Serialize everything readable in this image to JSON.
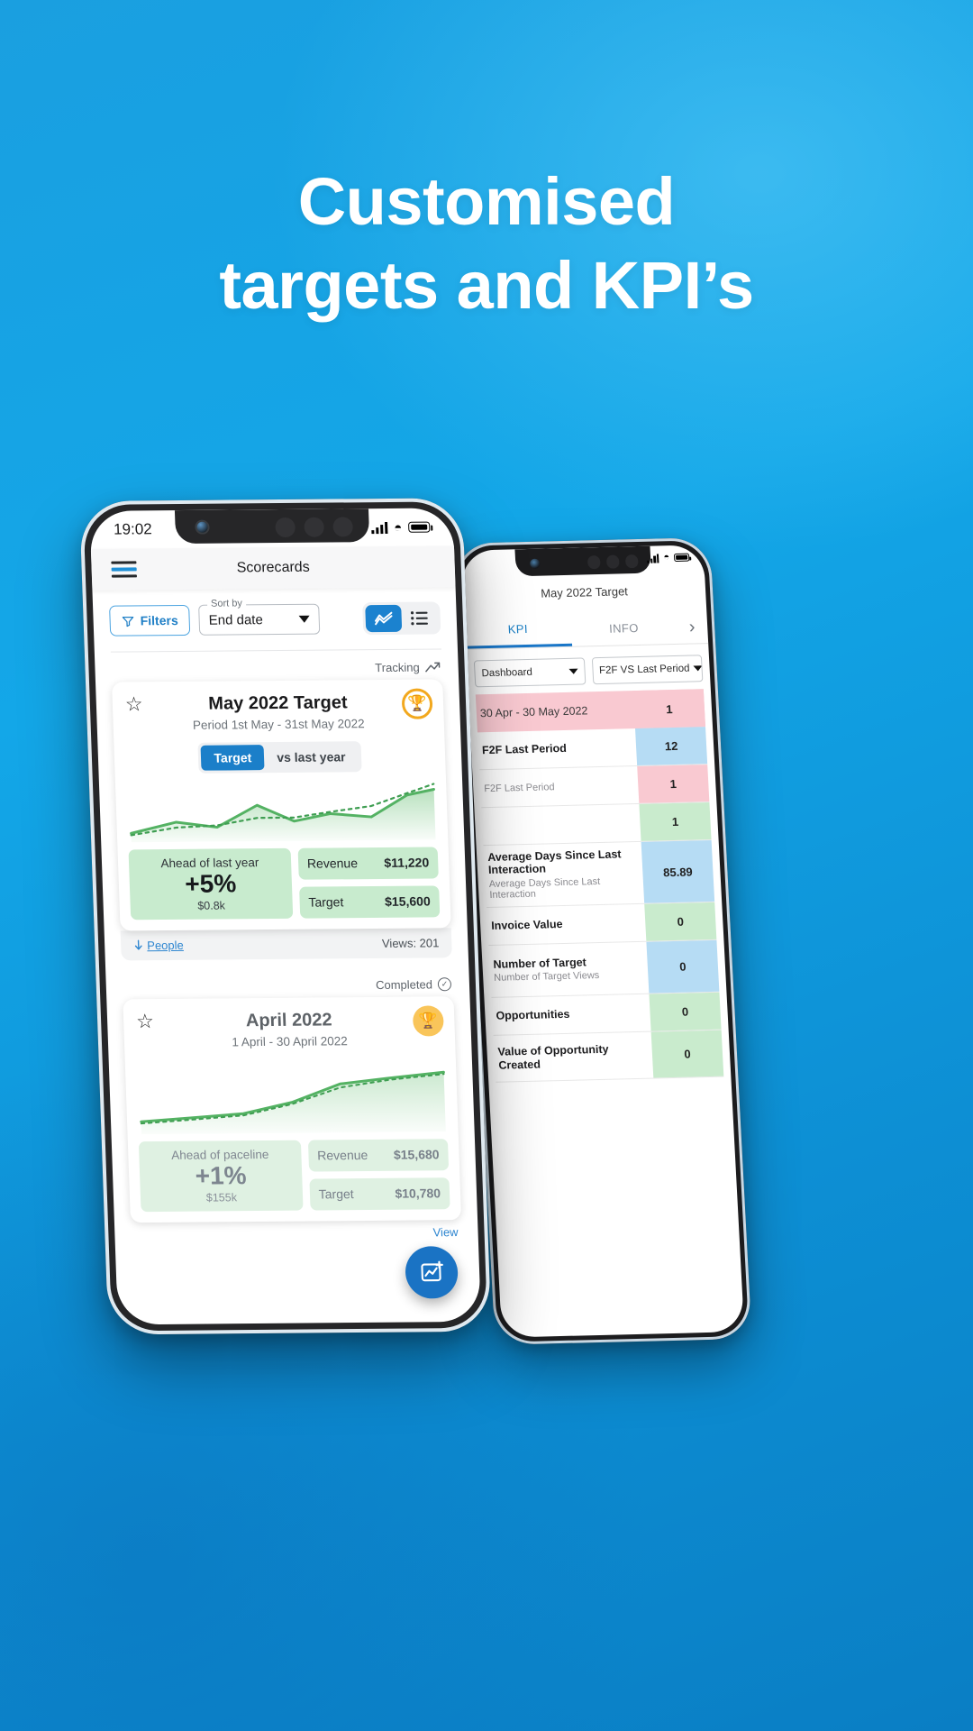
{
  "headline": {
    "line1": "Customised",
    "line2": "targets and KPI’s"
  },
  "left_phone": {
    "status": {
      "time": "19:02",
      "signal_icon": "cellular-bars-icon",
      "wifi_icon": "wifi-icon",
      "battery_icon": "battery-full-icon"
    },
    "appbar": {
      "menu_icon": "hamburger-menu-icon",
      "title": "Scorecards"
    },
    "toolbar": {
      "filters_label": "Filters",
      "filters_icon": "filter-funnel-icon",
      "sort_label": "Sort by",
      "sort_value": "End date",
      "sort_caret_icon": "chevron-down-icon",
      "chart_view_icon": "line-chart-icon",
      "list_view_icon": "list-view-icon"
    },
    "cards": [
      {
        "status_label": "Tracking",
        "status_icon": "trending-up-icon",
        "star_icon": "star-outline-icon",
        "badge_icon": "trophy-icon",
        "title": "May 2022 Target",
        "subtitle": "Period 1st May - 31st May 2022",
        "segmented": {
          "options": [
            "Target",
            "vs last year"
          ],
          "selected": "Target"
        },
        "metric_title": "Ahead of last year",
        "metric_value": "+5%",
        "metric_sub": "$0.8k",
        "rows": [
          {
            "label": "Revenue",
            "value": "$11,220"
          },
          {
            "label": "Target",
            "value": "$15,600"
          }
        ],
        "footer": {
          "people_label": "People",
          "people_icon": "download-arrow-icon",
          "views_label": "Views: 201"
        }
      },
      {
        "status_label": "Completed",
        "status_icon": "check-circle-icon",
        "star_icon": "star-outline-icon",
        "badge_icon": "trophy-icon",
        "title": "April 2022",
        "subtitle": "1 April - 30 April 2022",
        "metric_title": "Ahead of paceline",
        "metric_value": "+1%",
        "metric_sub": "$155k",
        "rows": [
          {
            "label": "Revenue",
            "value": "$15,680"
          },
          {
            "label": "Target",
            "value": "$10,780"
          }
        ],
        "footer": {
          "view_link": "View"
        }
      }
    ],
    "fab_icon": "add-chart-icon"
  },
  "right_phone": {
    "status": {
      "signal_icon": "cellular-bars-icon",
      "wifi_icon": "wifi-icon",
      "battery_icon": "battery-full-icon"
    },
    "title": "May 2022 Target",
    "tabs": {
      "items": [
        "KPI",
        "INFO"
      ],
      "selected": "KPI",
      "next_icon": "chevron-right-icon"
    },
    "selects": [
      {
        "value": "Dashboard",
        "caret_icon": "chevron-down-icon"
      },
      {
        "value": "F2F VS Last Period",
        "caret_icon": "chevron-down-icon"
      }
    ],
    "table": {
      "period_header": {
        "label": "30 Apr - 30 May 2022",
        "value": "1",
        "tint": "pink"
      },
      "rows": [
        {
          "label": "F2F Last Period",
          "sublabel": "",
          "value": "12",
          "tint": "blue"
        },
        {
          "label": "F2F Last Period",
          "sublabel": "",
          "value": "1",
          "tint": "pink"
        },
        {
          "label": "",
          "sublabel": "",
          "value": "1",
          "tint": "green"
        },
        {
          "label": "Average Days Since Last Interaction",
          "sublabel": "Average Days Since Last Interaction",
          "value": "85.89",
          "tint": "blue"
        },
        {
          "label": "Invoice Value",
          "sublabel": "",
          "value": "0",
          "tint": "green"
        },
        {
          "label": "Number of Target",
          "sublabel": "Number of Target Views",
          "value": "0",
          "tint": "blue"
        },
        {
          "label": "Opportunities",
          "sublabel": "",
          "value": "0",
          "tint": "green"
        },
        {
          "label": "Value of Opportunity Created",
          "sublabel": "",
          "value": "0",
          "tint": "green"
        }
      ]
    }
  },
  "colors": {
    "background_top": "#1a9fe0",
    "background_bottom": "#0a7ec4",
    "accent_blue": "#1b7fc9",
    "green": "#4caf50",
    "green_tint": "#c8ebce",
    "pink_tint": "#f9c9d1",
    "blue_tint": "#b6dcf4",
    "gold": "#f2a81e"
  }
}
